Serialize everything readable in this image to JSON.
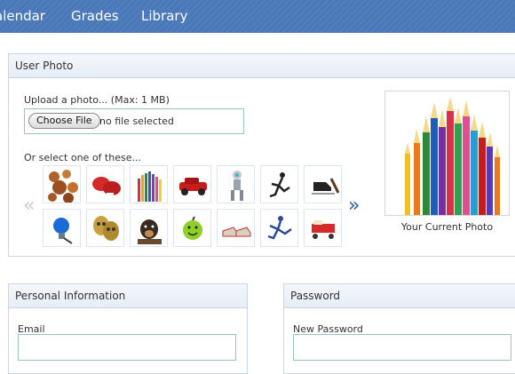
{
  "nav": {
    "items": [
      {
        "label": "alendar"
      },
      {
        "label": "Grades"
      },
      {
        "label": "Library"
      }
    ]
  },
  "user_photo": {
    "title": "User Photo",
    "upload_label": "Upload a photo... (Max: 1 MB)",
    "choose_file_label": "Choose File",
    "no_file_text": "no file selected",
    "select_label": "Or select one of these...",
    "thumbnails": [
      "balls-icon",
      "boxing-gloves-icon",
      "colored-pencils-icon",
      "red-car-icon",
      "robot-icon",
      "runner-icon",
      "hockey-skate-icon",
      "blue-bulb-icon",
      "theater-masks-icon",
      "dog-icon",
      "smiley-apple-icon",
      "sneakers-icon",
      "runner-2-icon",
      "red-cart-icon"
    ],
    "prev_arrow": "«",
    "next_arrow": "»",
    "current_photo_label": "Your Current Photo"
  },
  "personal_info": {
    "title": "Personal Information",
    "email_label": "Email",
    "email_value": ""
  },
  "password": {
    "title": "Password",
    "new_password_label": "New Password",
    "new_password_value": ""
  }
}
